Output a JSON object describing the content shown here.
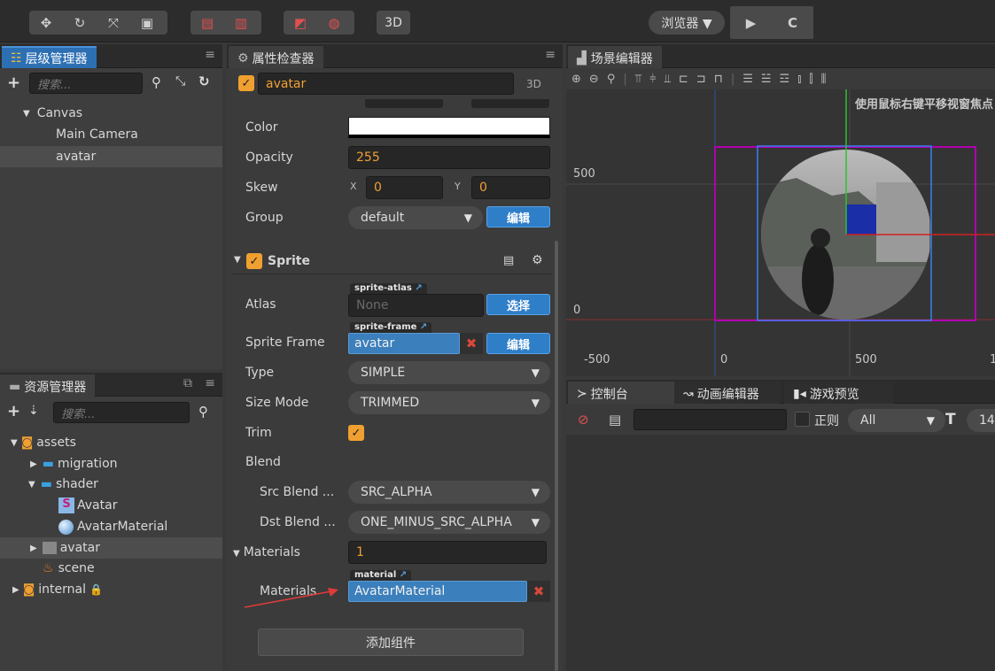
{
  "toolbar": {
    "tool_icons": [
      "move-icon",
      "rotate-icon",
      "scale-icon",
      "rect-icon"
    ],
    "preview_label": "浏览器 ▼",
    "mode_3d": "3D",
    "play_icon": "▶",
    "refresh_icon": "C"
  },
  "hierarchy": {
    "tab": "层级管理器",
    "search_placeholder": "搜索...",
    "nodes": [
      "Canvas",
      "Main Camera",
      "avatar"
    ]
  },
  "assets": {
    "tab": "资源管理器",
    "search_placeholder": "搜索...",
    "nodes": [
      "assets",
      "migration",
      "shader",
      "Avatar",
      "AvatarMaterial",
      "avatar",
      "scene",
      "internal"
    ]
  },
  "inspector": {
    "tab": "属性检查器",
    "node_name": "avatar",
    "badge_3d": "3D",
    "color_label": "Color",
    "opacity_label": "Opacity",
    "opacity_value": "255",
    "skew_label": "Skew",
    "skew_x_label": "X",
    "skew_x": "0",
    "skew_y_label": "Y",
    "skew_y": "0",
    "group_label": "Group",
    "group_value": "default",
    "edit_label": "编辑",
    "sprite_title": "Sprite",
    "atlas_label": "Atlas",
    "atlas_tag": "sprite-atlas",
    "atlas_value": "None",
    "choose_label": "选择",
    "frame_label": "Sprite Frame",
    "frame_tag": "sprite-frame",
    "frame_value": "avatar",
    "type_label": "Type",
    "type_value": "SIMPLE",
    "sizemode_label": "Size Mode",
    "sizemode_value": "TRIMMED",
    "trim_label": "Trim",
    "blend_label": "Blend",
    "src_label": "Src Blend ...",
    "src_value": "SRC_ALPHA",
    "dst_label": "Dst Blend ...",
    "dst_value": "ONE_MINUS_SRC_ALPHA",
    "materials_label": "Materials",
    "materials_count": "1",
    "material_tag": "material",
    "material_item_label": "Materials",
    "material_value": "AvatarMaterial",
    "add_component": "添加组件"
  },
  "scene": {
    "tab": "场景编辑器",
    "hint": "使用鼠标右键平移视窗焦点",
    "y_labels": [
      "500",
      "0"
    ],
    "x_labels": [
      "-500",
      "0",
      "500",
      "1"
    ]
  },
  "console": {
    "tabs": [
      "控制台",
      "动画编辑器",
      "游戏预览"
    ],
    "regex_label": "正则",
    "level_value": "All",
    "font_size": "14"
  },
  "colors": {
    "accent_blue": "#2f7ec8",
    "check_orange": "#f0a030",
    "value_orange": "#f2a134",
    "error_red": "#d9483b",
    "frame_magenta": "#b000b0"
  }
}
